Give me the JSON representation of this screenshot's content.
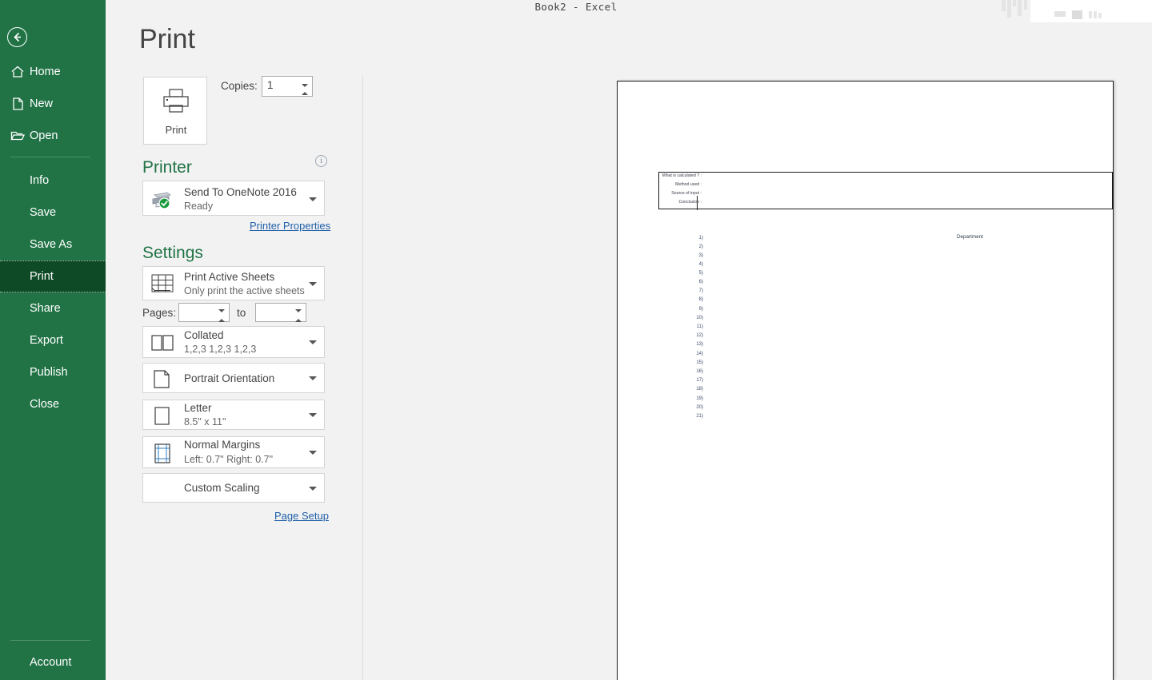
{
  "titlebar": {
    "caption": "Book2  -  Excel"
  },
  "sidebar": {
    "back_icon": "back-arrow-icon",
    "top_items": [
      {
        "label": "Home",
        "icon": "home-icon"
      },
      {
        "label": "New",
        "icon": "new-document-icon"
      },
      {
        "label": "Open",
        "icon": "open-folder-icon"
      }
    ],
    "main_items": [
      {
        "label": "Info",
        "selected": false
      },
      {
        "label": "Save",
        "selected": false
      },
      {
        "label": "Save As",
        "selected": false
      },
      {
        "label": "Print",
        "selected": true
      },
      {
        "label": "Share",
        "selected": false
      },
      {
        "label": "Export",
        "selected": false
      },
      {
        "label": "Publish",
        "selected": false
      },
      {
        "label": "Close",
        "selected": false
      }
    ],
    "bottom_items": [
      {
        "label": "Account"
      }
    ],
    "colors": {
      "background": "#217346",
      "selected_background": "#0e4a25",
      "text": "#ffffff"
    }
  },
  "page": {
    "title": "Print"
  },
  "print_button": {
    "label": "Print",
    "icon": "printer-icon"
  },
  "copies": {
    "label": "Copies:",
    "value": "1"
  },
  "printer_section": {
    "heading": "Printer",
    "info_icon": "info-icon",
    "selected_printer": {
      "name": "Send To OneNote 2016",
      "status": "Ready",
      "icon": "printer-ready-icon"
    },
    "properties_link": "Printer Properties"
  },
  "settings_section": {
    "heading": "Settings",
    "items": [
      {
        "title": "Print Active Sheets",
        "subtitle": "Only print the active sheets",
        "icon": "sheet-grid-icon"
      },
      {
        "title": "Collated",
        "subtitle": "1,2,3   1,2,3   1,2,3",
        "icon": "collate-icon"
      },
      {
        "title": "Portrait Orientation",
        "subtitle": "",
        "icon": "portrait-page-icon"
      },
      {
        "title": "Letter",
        "subtitle": "8.5\" x 11\"",
        "icon": "paper-size-icon"
      },
      {
        "title": "Normal Margins",
        "subtitle": "Left:  0.7\"   Right:  0.7\"",
        "icon": "margins-icon"
      },
      {
        "title": "Custom Scaling",
        "subtitle": "",
        "icon": "scaling-icon"
      }
    ],
    "pages": {
      "label": "Pages:",
      "from_value": "",
      "to_label": "to",
      "to_value": ""
    },
    "page_setup_link": "Page Setup"
  },
  "preview": {
    "header_rows": [
      "What is calculated ? :",
      "Method used :",
      "Source of input :",
      "Conclusion :"
    ],
    "department_label": "Department",
    "row_numbers": [
      "1)",
      "2)",
      "3)",
      "4)",
      "5)",
      "6)",
      "7)",
      "8)",
      "9)",
      "10)",
      "11)",
      "12)",
      "13)",
      "14)",
      "15)",
      "16)",
      "17)",
      "18)",
      "19)",
      "20)",
      "21)"
    ]
  }
}
